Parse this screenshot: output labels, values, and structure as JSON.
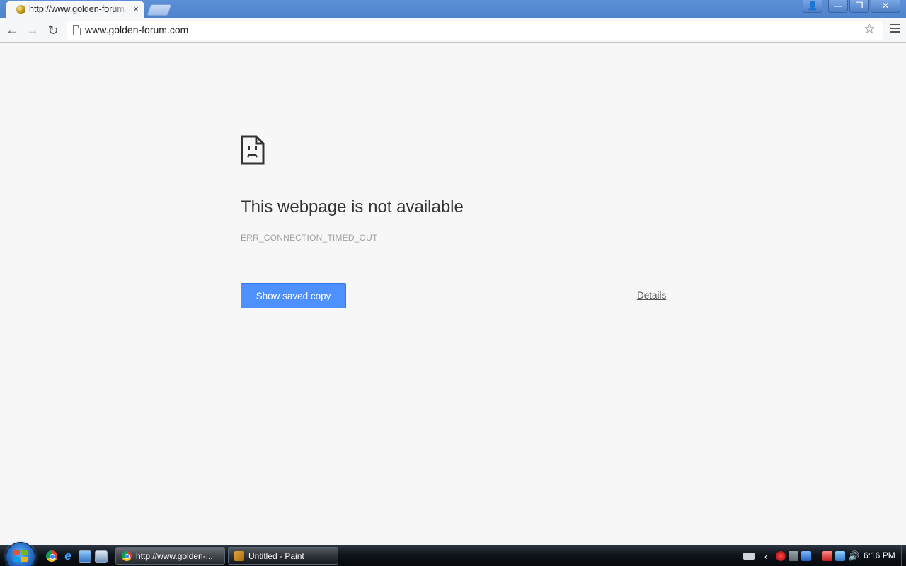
{
  "browser": {
    "tab": {
      "title": "http://www.golden-forum.com",
      "close_glyph": "×"
    },
    "window_controls": {
      "user": "👤",
      "minimize": "—",
      "restore": "❐",
      "close": "✕"
    },
    "toolbar": {
      "back_glyph": "←",
      "forward_glyph": "→",
      "reload_glyph": "↻",
      "url": "www.golden-forum.com",
      "star_glyph": "☆"
    }
  },
  "error_page": {
    "title": "This webpage is not available",
    "code": "ERR_CONNECTION_TIMED_OUT",
    "show_saved_copy_label": "Show saved copy",
    "details_label": "Details"
  },
  "taskbar": {
    "items": [
      {
        "label": "http://www.golden-...",
        "icon": "chrome-icon",
        "active": true
      },
      {
        "label": "Untitled - Paint",
        "icon": "paint-icon",
        "active": false
      }
    ],
    "quick_launch": [
      "chrome-icon",
      "internet-explorer-icon",
      "show-desktop-icon",
      "switch-windows-icon"
    ],
    "tray": {
      "chevron_glyph": "‹",
      "volume_glyph": "🔊"
    },
    "clock": "6:16 PM"
  },
  "colors": {
    "page_background": "#f7f7f7",
    "button_blue": "#4d90fe",
    "title_text": "#333333",
    "error_code_text": "#a0a0a0"
  }
}
